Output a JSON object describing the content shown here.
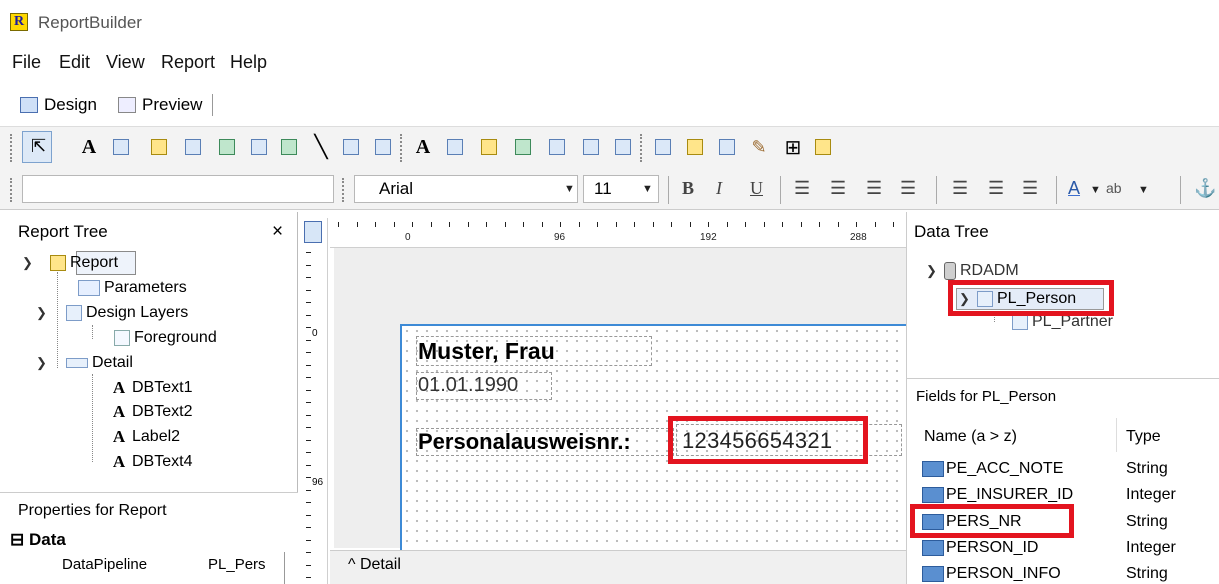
{
  "app": {
    "title": "ReportBuilder",
    "logo_letter": "R"
  },
  "menu": [
    "File",
    "Edit",
    "View",
    "Report",
    "Help"
  ],
  "tabs": [
    {
      "label": "Design"
    },
    {
      "label": "Preview"
    }
  ],
  "format_toolbar": {
    "font": "Arial",
    "size": "11",
    "bold": "B",
    "italic": "I",
    "underline": "U"
  },
  "report_tree": {
    "title": "Report Tree",
    "close": "×",
    "nodes": [
      "Report",
      "Parameters",
      "Design Layers",
      "Foreground",
      "Detail",
      "DBText1",
      "DBText2",
      "Label2",
      "DBText4"
    ]
  },
  "properties": {
    "title": "Properties for Report",
    "section": "Data",
    "section_toggle": "⊟",
    "row_name": "DataPipeline",
    "row_value": "PL_Pers"
  },
  "ruler": {
    "marks": [
      "0",
      "96",
      "192",
      "288"
    ],
    "v_marks": [
      "0",
      "96"
    ]
  },
  "canvas": {
    "name": "Muster, Frau",
    "date": "01.01.1990",
    "label": "Personalausweisnr.:",
    "id_value": "123456654321",
    "band": "Detail",
    "band_caret": "^"
  },
  "data_tree": {
    "title": "Data Tree",
    "root": "RDADM",
    "selected": "PL_Person",
    "child": "PL_Partner"
  },
  "fields": {
    "title": "Fields for PL_Person",
    "col_name": "Name (a > z)",
    "col_type": "Type",
    "rows": [
      {
        "name": "PE_ACC_NOTE",
        "type": "String"
      },
      {
        "name": "PE_INSURER_ID",
        "type": "Integer"
      },
      {
        "name": "PERS_NR",
        "type": "String"
      },
      {
        "name": "PERSON_ID",
        "type": "Integer"
      },
      {
        "name": "PERSON_INFO",
        "type": "String"
      }
    ]
  },
  "colors": {
    "highlight": "#e3141f",
    "page_border": "#3d8ad6"
  }
}
